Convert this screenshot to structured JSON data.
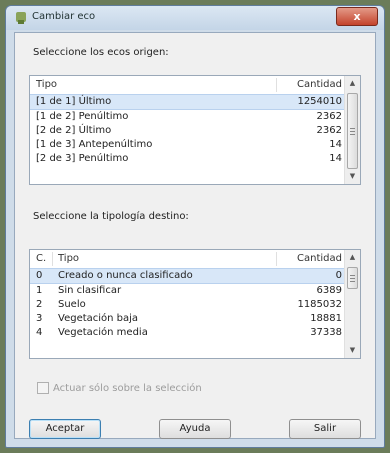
{
  "window": {
    "title": "Cambiar eco",
    "close_label": "x"
  },
  "origin": {
    "label": "Seleccione los ecos origen:",
    "headers": {
      "type": "Tipo",
      "count": "Cantidad"
    },
    "rows": [
      {
        "type": "[1 de 1] Último",
        "count": "1254010",
        "selected": true
      },
      {
        "type": "[1 de 2] Penúltimo",
        "count": "2362"
      },
      {
        "type": "[2 de 2] Último",
        "count": "2362"
      },
      {
        "type": "[1 de 3] Antepenúltimo",
        "count": "14"
      },
      {
        "type": "[2 de 3] Penúltimo",
        "count": "14"
      }
    ]
  },
  "target": {
    "label": "Seleccione la tipología destino:",
    "headers": {
      "code": "C.",
      "type": "Tipo",
      "count": "Cantidad"
    },
    "rows": [
      {
        "code": "0",
        "type": "Creado o nunca clasificado",
        "count": "0",
        "selected": true
      },
      {
        "code": "1",
        "type": "Sin clasificar",
        "count": "6389"
      },
      {
        "code": "2",
        "type": "Suelo",
        "count": "1185032"
      },
      {
        "code": "3",
        "type": "Vegetación baja",
        "count": "18881"
      },
      {
        "code": "4",
        "type": "Vegetación media",
        "count": "37338"
      }
    ]
  },
  "only_selection": {
    "label": "Actuar sólo sobre la selección",
    "checked": false,
    "enabled": false
  },
  "buttons": {
    "accept": "Aceptar",
    "help": "Ayuda",
    "exit": "Salir"
  },
  "icons": {
    "window": "app-icon",
    "scroll_up": "chevron-up-icon",
    "scroll_down": "chevron-down-icon"
  },
  "colors": {
    "selection": "#d8e7f8",
    "title_bar": "#cfdce9",
    "close": "#c3432c"
  }
}
